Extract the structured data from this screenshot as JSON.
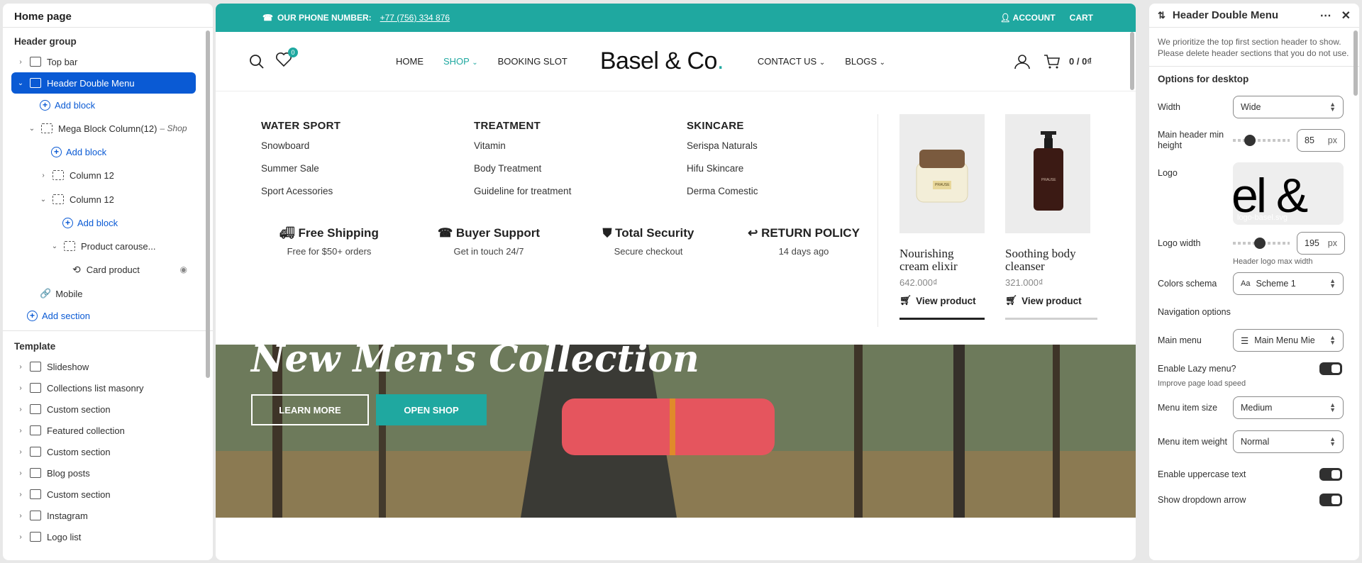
{
  "left": {
    "title": "Home page",
    "header_group": "Header group",
    "items": [
      {
        "label": "Top bar"
      },
      {
        "label": "Header Double Menu"
      },
      {
        "label": "Add block"
      },
      {
        "label": "Mega Block Column(12)",
        "suffix": "– Shop"
      },
      {
        "label": "Add block"
      },
      {
        "label": "Column 12"
      },
      {
        "label": "Column 12"
      },
      {
        "label": "Add block"
      },
      {
        "label": "Product carouse..."
      },
      {
        "label": "Card product"
      },
      {
        "label": "Mobile"
      },
      {
        "label": "Add section"
      }
    ],
    "template": "Template",
    "template_items": [
      "Slideshow",
      "Collections list masonry",
      "Custom section",
      "Featured collection",
      "Custom section",
      "Blog posts",
      "Custom section",
      "Instagram",
      "Logo list"
    ]
  },
  "store": {
    "topbar": {
      "phone_label": "OUR PHONE NUMBER:",
      "phone": "+77 (756) 334 876",
      "account": "ACCOUNT",
      "cart": "CART"
    },
    "nav": [
      "HOME",
      "SHOP",
      "BOOKING SLOT"
    ],
    "logo": "Basel & Co",
    "logo_dot": ".",
    "nav2": [
      "CONTACT US",
      "BLOGS"
    ],
    "wishlist_count": "0",
    "cart_total": "0 / 0₫",
    "mega": {
      "columns": [
        {
          "title": "WATER SPORT",
          "links": [
            "Snowboard",
            "Summer Sale",
            "Sport Acessories"
          ]
        },
        {
          "title": "TREATMENT",
          "links": [
            "Vitamin",
            "Body Treatment",
            "Guideline for treatment"
          ]
        },
        {
          "title": "SKINCARE",
          "links": [
            "Serispa Naturals",
            "Hifu Skincare",
            "Derma Comestic"
          ]
        }
      ],
      "features": [
        {
          "title": "Free Shipping",
          "sub": "Free for $50+ orders"
        },
        {
          "title": "Buyer Support",
          "sub": "Get in touch 24/7"
        },
        {
          "title": "Total Security",
          "sub": "Secure checkout"
        },
        {
          "title": "RETURN POLICY",
          "sub": "14 days ago"
        }
      ],
      "products": [
        {
          "name": "Nourishing cream elixir",
          "price": "642.000₫",
          "cta": "View product",
          "jar_label": "PRAUSE"
        },
        {
          "name": "Soothing body cleanser",
          "price": "321.000₫",
          "cta": "View product",
          "bottle_label": "PRAUSE"
        }
      ]
    },
    "hero": {
      "title": "New Men's Collection",
      "btn1": "LEARN MORE",
      "btn2": "OPEN SHOP"
    }
  },
  "right": {
    "title": "Header Double Menu",
    "desc": "We prioritize the top first section header to show. Please delete header sections that you do not use.",
    "section_desktop": "Options for desktop",
    "width_label": "Width",
    "width_value": "Wide",
    "min_height_label": "Main header min height",
    "min_height_value": "85",
    "unit": "px",
    "logo_label": "Logo",
    "logo_file": "logo-basel.svg",
    "logo_preview": "el &",
    "logo_width_label": "Logo width",
    "logo_width_value": "195",
    "logo_width_help": "Header logo max width",
    "colors_label": "Colors schema",
    "colors_value": "Scheme 1",
    "nav_options": "Navigation options",
    "main_menu_label": "Main menu",
    "main_menu_value": "Main Menu Mie",
    "lazy_label": "Enable Lazy menu?",
    "lazy_help": "Improve page load speed",
    "size_label": "Menu item size",
    "size_value": "Medium",
    "weight_label": "Menu item weight",
    "weight_value": "Normal",
    "uppercase_label": "Enable uppercase text",
    "dropdown_label": "Show dropdown arrow"
  }
}
